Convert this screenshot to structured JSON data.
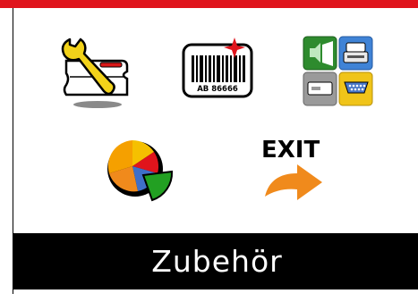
{
  "menu": {
    "items": [
      {
        "id": "service",
        "icon": "wrench-printer-icon"
      },
      {
        "id": "barcode",
        "icon": "barcode-label-icon",
        "barcode_text": "AB 86666"
      },
      {
        "id": "interfaces",
        "icon": "interfaces-icon"
      },
      {
        "id": "statistics",
        "icon": "pie-chart-icon"
      },
      {
        "id": "exit",
        "icon": "exit-arrow-icon",
        "label": "EXIT"
      }
    ]
  },
  "status": {
    "title": "Zubehör"
  },
  "colors": {
    "accent": "#e0141c",
    "status_bar": "#000000",
    "status_text": "#ffffff",
    "exit_arrow": "#f08a1c"
  }
}
